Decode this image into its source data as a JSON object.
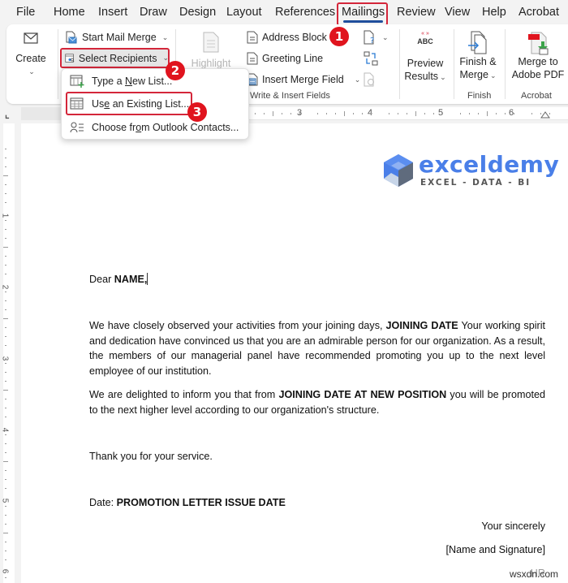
{
  "menu_tabs": [
    {
      "label": "File"
    },
    {
      "label": "Home"
    },
    {
      "label": "Insert"
    },
    {
      "label": "Draw"
    },
    {
      "label": "Design"
    },
    {
      "label": "Layout"
    },
    {
      "label": "References"
    },
    {
      "label": "Mailings",
      "active": true
    },
    {
      "label": "Review"
    },
    {
      "label": "View"
    },
    {
      "label": "Help"
    },
    {
      "label": "Acrobat"
    }
  ],
  "ribbon": {
    "create": {
      "label": "Create",
      "icon": "envelope-icon"
    },
    "start_mail_merge": {
      "label": "Start Mail Merge",
      "icon": "start-mail-merge-icon"
    },
    "select_recipients": {
      "label": "Select Recipients",
      "icon": "select-recipients-icon"
    },
    "highlight": {
      "label": "Highlight",
      "icon": "highlight-merge-fields-icon",
      "disabled": true
    },
    "address_block": {
      "label": "Address Block",
      "icon": "address-block-icon"
    },
    "greeting_line": {
      "label": "Greeting Line",
      "icon": "greeting-line-icon"
    },
    "insert_merge_field": {
      "label": "Insert Merge Field",
      "icon": "insert-merge-field-icon"
    },
    "rules_icon": "rules-icon",
    "match_fields_icon": "match-fields-icon",
    "update_labels_icon": "update-labels-icon",
    "write_insert_group": "Write & Insert Fields",
    "preview_results": {
      "line1": "Preview",
      "line2": "Results",
      "icon": "abc-preview-icon",
      "icon_text": "ABC"
    },
    "finish_merge": {
      "line1": "Finish &",
      "line2": "Merge",
      "icon": "finish-merge-icon"
    },
    "finish_group": "Finish",
    "merge_to_pdf": {
      "line1": "Merge to",
      "line2": "Adobe PDF",
      "icon": "merge-to-pdf-icon"
    },
    "acrobat_group": "Acrobat"
  },
  "dropdown": {
    "items": [
      {
        "pre": "Type a ",
        "ul": "N",
        "post": "ew List...",
        "icon": "type-new-list-icon"
      },
      {
        "pre": "Us",
        "ul": "e",
        "post": " an Existing List...",
        "icon": "existing-list-icon"
      },
      {
        "pre": "Choose fr",
        "ul": "o",
        "post": "m Outlook Contacts...",
        "icon": "outlook-contacts-icon"
      }
    ]
  },
  "annotations": {
    "badge_1": "1",
    "badge_2": "2",
    "badge_3": "3",
    "highlight_color": "#d4263a",
    "badge_color": "#e0141e"
  },
  "ruler": {
    "horizontal_numbers": [
      "3",
      "4",
      "5",
      "6"
    ],
    "vertical_numbers": [
      "1",
      "2",
      "3",
      "4",
      "5",
      "6"
    ]
  },
  "logo": {
    "name": "exceldemy",
    "tagline": "EXCEL - DATA - BI",
    "color": "#4a7fe8"
  },
  "document": {
    "greeting": {
      "text": "Dear ",
      "field": "NAME,"
    },
    "para1": {
      "pre": "We have closely observed your activities from your joining days, ",
      "field": "JOINING DATE",
      "post": " Your working spirit and dedication have convinced us that you are an admirable person for our organization. As a result, the members of our managerial panel have recommended promoting you up to the next level employee of our institution."
    },
    "para2": {
      "pre": "We are delighted to inform you that from ",
      "field": "JOINING DATE AT NEW POSITION",
      "post": " you will be promoted to the next higher level according to our organization's structure."
    },
    "thanks": "Thank you for your service.",
    "date": {
      "label": "Date: ",
      "field": "PROMOTION LETTER ISSUE DATE"
    },
    "closing": "Your sincerely",
    "signature": "[Name and Signature]",
    "hr": "HR"
  },
  "watermark": "wsxdn.com"
}
